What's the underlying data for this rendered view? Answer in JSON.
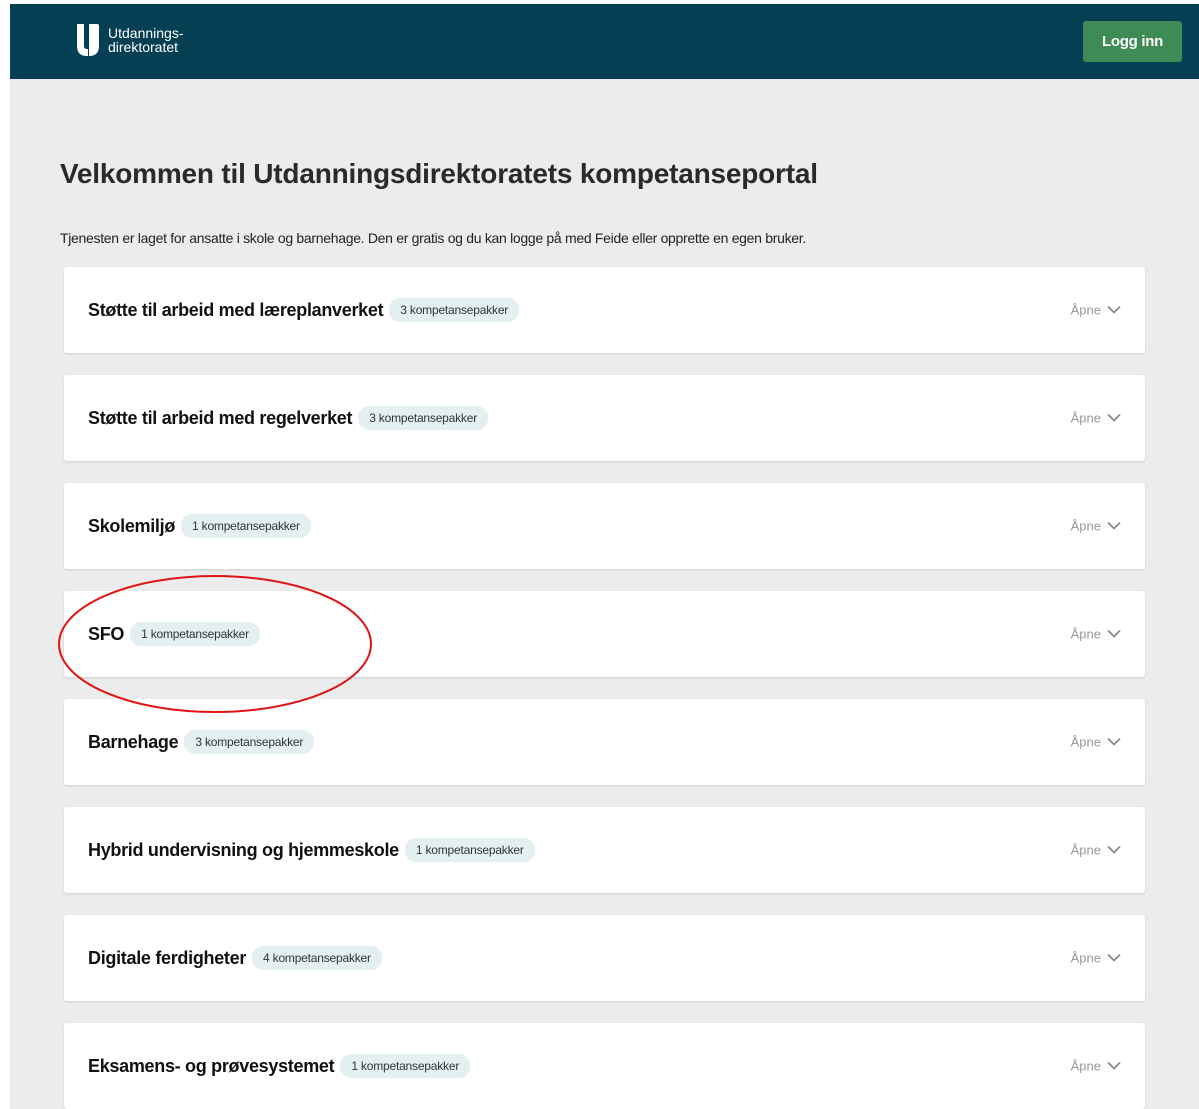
{
  "header": {
    "logo_line1": "Utdannings-",
    "logo_line2": "direktoratet",
    "login_label": "Logg inn"
  },
  "main": {
    "title": "Velkommen til Utdanningsdirektoratets kompetanseportal",
    "intro": "Tjenesten er laget for ansatte i skole og barnehage. Den er gratis og du kan logge på med Feide eller opprette en egen bruker.",
    "open_label": "Åpne",
    "sections": [
      {
        "title": "Støtte til arbeid med læreplanverket",
        "badge": "3 kompetansepakker"
      },
      {
        "title": "Støtte til arbeid med regelverket",
        "badge": "3 kompetansepakker"
      },
      {
        "title": "Skolemiljø",
        "badge": "1 kompetansepakker"
      },
      {
        "title": "SFO",
        "badge": "1 kompetansepakker"
      },
      {
        "title": "Barnehage",
        "badge": "3 kompetansepakker"
      },
      {
        "title": "Hybrid undervisning og hjemmeskole",
        "badge": "1 kompetansepakker"
      },
      {
        "title": "Digitale ferdigheter",
        "badge": "4 kompetansepakker"
      },
      {
        "title": "Eksamens- og prøvesystemet",
        "badge": "1 kompetansepakker"
      }
    ]
  },
  "colors": {
    "header_bg": "#053f53",
    "login_bg": "#3f8b55",
    "page_bg": "#ececec",
    "badge_bg": "#e3eff1",
    "annotation": "#e01414"
  },
  "icons": {
    "logo": "udir-logo-icon",
    "expand": "chevron-down-icon"
  }
}
